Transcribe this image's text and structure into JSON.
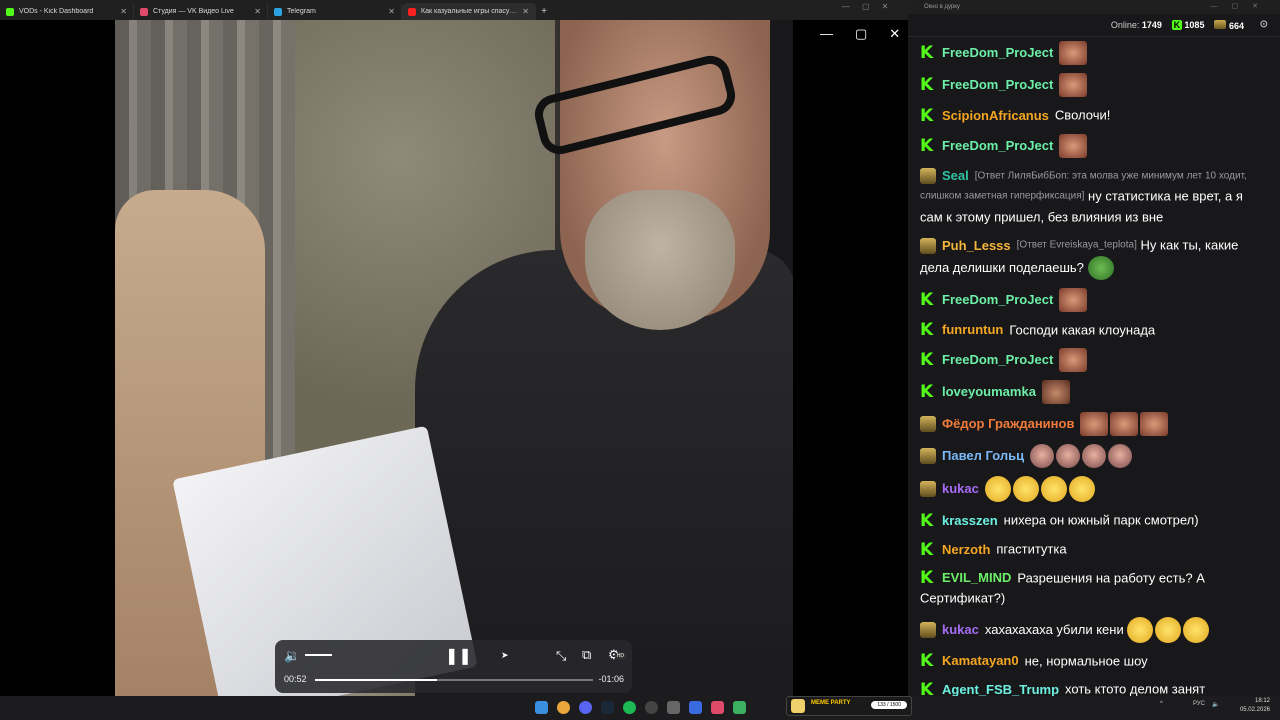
{
  "browser": {
    "tabs": [
      {
        "title": "VODs - Kick Dashboard",
        "favicon_color": "#53fc18",
        "active": false
      },
      {
        "title": "Студия — VK Видео Live",
        "favicon_color": "#e04a6a",
        "active": false
      },
      {
        "title": "Telegram",
        "favicon_color": "#2aa3e0",
        "active": false
      },
      {
        "title": "Как казуальные игры спасут т...",
        "favicon_color": "#ff2020",
        "active": true
      }
    ],
    "new_tab_label": "+"
  },
  "player": {
    "elapsed": "00:52",
    "remaining": "-01:06",
    "progress": 0.44,
    "volume": 0.5,
    "hd_badge": "HD"
  },
  "chat": {
    "window_title": "Окно в дурку",
    "online_label": "Online:",
    "online_count": "1749",
    "kick_count": "1085",
    "vk_count": "664",
    "messages": [
      {
        "badge": "k",
        "user": "FreeDom_ProJect",
        "color": "#6cf0a8",
        "text": "",
        "emotes": [
          "face"
        ]
      },
      {
        "badge": "k",
        "user": "FreeDom_ProJect",
        "color": "#6cf0a8",
        "text": "",
        "emotes": [
          "face"
        ]
      },
      {
        "badge": "k",
        "user": "ScipionAfricanus",
        "color": "#f5a623",
        "text": "Сволочи!",
        "emotes": []
      },
      {
        "badge": "k",
        "user": "FreeDom_ProJect",
        "color": "#6cf0a8",
        "text": "",
        "emotes": [
          "face"
        ]
      },
      {
        "badge": "g",
        "user": "Seal",
        "color": "#2ec4a0",
        "reply": "[Ответ ЛиляБибБоп: эта молва уже минимум лет 10 ходит, слишком заметная гиперфиксация]",
        "text": "ну статистика не врет, а я сам к этому пришел, без влияния из вне",
        "emotes": []
      },
      {
        "badge": "g",
        "user": "Puh_Lesss",
        "color": "#f5b63a",
        "reply": "[Ответ Evreiskaya_teplota]",
        "text": "Ну как ты, какие дела делишки поделаешь?",
        "emotes": [
          "pepe"
        ]
      },
      {
        "badge": "k",
        "user": "FreeDom_ProJect",
        "color": "#6cf0a8",
        "text": "",
        "emotes": [
          "face"
        ]
      },
      {
        "badge": "k",
        "user": "funruntun",
        "color": "#f5a623",
        "text": "Господи какая клоунада",
        "emotes": []
      },
      {
        "badge": "k",
        "user": "FreeDom_ProJect",
        "color": "#6cf0a8",
        "text": "",
        "emotes": [
          "face"
        ]
      },
      {
        "badge": "k",
        "user": "loveyoumamka",
        "color": "#6cf0a8",
        "text": "",
        "emotes": [
          "dog"
        ]
      },
      {
        "badge": "g",
        "user": "Фёдор Гражданинов",
        "color": "#f07a3a",
        "text": "",
        "emotes": [
          "face",
          "face",
          "face"
        ]
      },
      {
        "badge": "g",
        "user": "Павел Гольц",
        "color": "#7ab8f5",
        "text": "",
        "emotes": [
          "girl",
          "girl",
          "girl",
          "girl"
        ]
      },
      {
        "badge": "g",
        "user": "kukac",
        "color": "#a66cf5",
        "text": "",
        "emotes": [
          "laugh",
          "laugh",
          "laugh",
          "laugh"
        ]
      },
      {
        "badge": "k",
        "user": "krasszen",
        "color": "#6cf0e0",
        "text": "нихера он южный парк смотрел)",
        "emotes": []
      },
      {
        "badge": "k",
        "user": "Nerzoth",
        "color": "#f5a623",
        "text": "пгаститутка",
        "emotes": []
      },
      {
        "badge": "k",
        "user": "EVIL_MIND",
        "color": "#6cf068",
        "text": "Разрешения на работу есть? А Сертификат?)",
        "emotes": []
      },
      {
        "badge": "g",
        "user": "kukac",
        "color": "#a66cf5",
        "text": "хахахахаха убили кени",
        "emotes": [
          "laugh",
          "laugh",
          "laugh"
        ]
      },
      {
        "badge": "k",
        "user": "Kamatayan0",
        "color": "#f5a623",
        "text": "не, нормальное шоу",
        "emotes": []
      },
      {
        "badge": "k",
        "user": "Agent_FSB_Trump",
        "color": "#6cf0e0",
        "text": "хоть ктото делом занят",
        "emotes": []
      }
    ]
  },
  "taskbar": {
    "meme_widget_label": "MEME PARTY",
    "meme_widget_count": "133 / 1500",
    "language": "РУС",
    "time": "18:12",
    "date": "05.02.2026"
  }
}
